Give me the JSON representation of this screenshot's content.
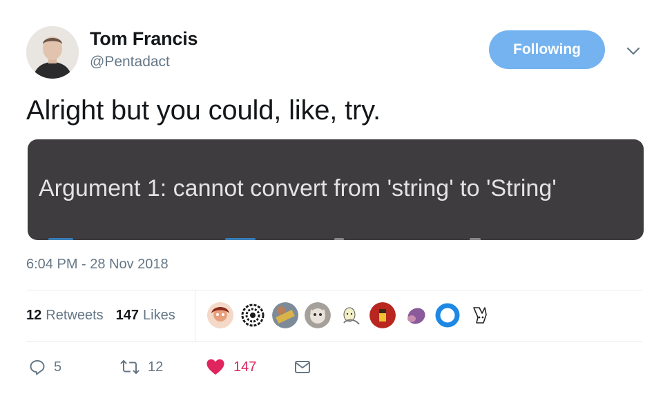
{
  "author": {
    "display_name": "Tom Francis",
    "handle": "@Pentadact"
  },
  "follow_button": {
    "label": "Following",
    "color": "#74b3f0"
  },
  "tweet": {
    "text": "Alright but you could, like, try.",
    "media_text": "Argument 1: cannot convert from 'string' to 'String'",
    "timestamp": "6:04 PM - 28 Nov 2018"
  },
  "stats": {
    "retweets_count": "12",
    "retweets_label": "Retweets",
    "likes_count": "147",
    "likes_label": "Likes"
  },
  "liker_avatars": [
    {
      "name": "liker-avatar-1"
    },
    {
      "name": "liker-avatar-2"
    },
    {
      "name": "liker-avatar-3"
    },
    {
      "name": "liker-avatar-4"
    },
    {
      "name": "liker-avatar-5"
    },
    {
      "name": "liker-avatar-6"
    },
    {
      "name": "liker-avatar-7"
    },
    {
      "name": "liker-avatar-8"
    },
    {
      "name": "liker-avatar-9"
    }
  ],
  "actions": {
    "reply_count": "5",
    "retweet_count": "12",
    "like_count": "147",
    "reply_icon": "reply-icon",
    "retweet_icon": "retweet-icon",
    "like_icon": "heart-icon",
    "dm_icon": "envelope-icon"
  },
  "colors": {
    "accent": "#1da1f2",
    "like": "#e0245e",
    "secondary_text": "#657786"
  }
}
